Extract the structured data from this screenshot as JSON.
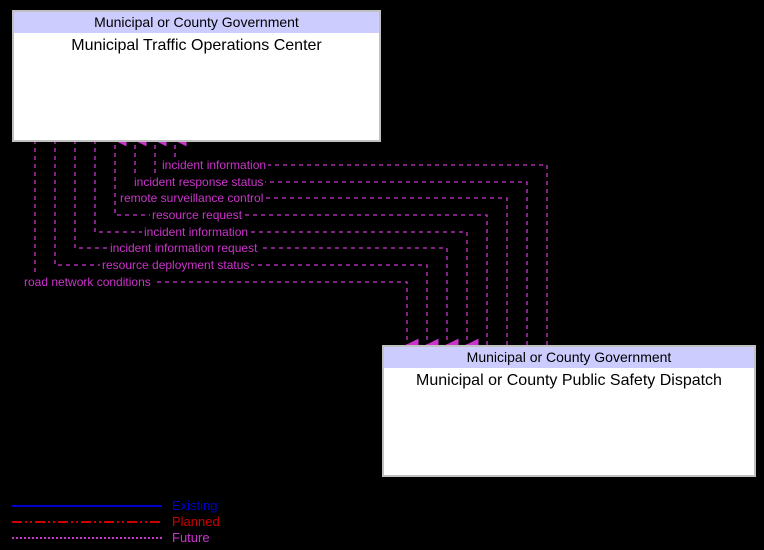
{
  "boxes": {
    "top": {
      "header": "Municipal or County Government",
      "title": "Municipal Traffic Operations Center"
    },
    "bottom": {
      "header": "Municipal or County Government",
      "title": "Municipal or County Public Safety Dispatch"
    }
  },
  "flows": {
    "f1": "incident information",
    "f2": "incident response status",
    "f3": "remote surveillance control",
    "f4": "resource request",
    "f5": "incident information",
    "f6": "incident information request",
    "f7": "resource deployment status",
    "f8": "road network conditions"
  },
  "legend": {
    "existing": {
      "label": "Existing",
      "color": "#0000cc"
    },
    "planned": {
      "label": "Planned",
      "color": "#cc0000"
    },
    "future": {
      "label": "Future",
      "color": "#cc33cc"
    }
  },
  "style": {
    "future_color": "#cc33cc",
    "dash": "4,4"
  }
}
